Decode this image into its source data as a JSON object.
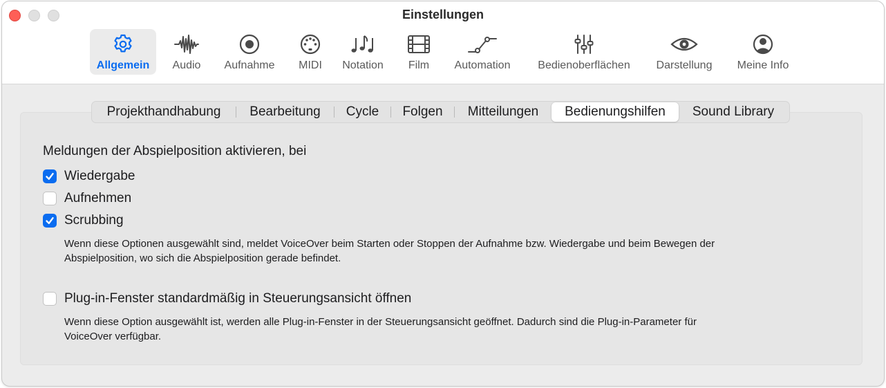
{
  "window": {
    "title": "Einstellungen"
  },
  "toolbar": {
    "items": [
      {
        "label": "Allgemein",
        "icon": "gear-icon",
        "active": true
      },
      {
        "label": "Audio",
        "icon": "waveform-icon"
      },
      {
        "label": "Aufnahme",
        "icon": "record-icon"
      },
      {
        "label": "MIDI",
        "icon": "midi-port-icon"
      },
      {
        "label": "Notation",
        "icon": "music-notes-icon"
      },
      {
        "label": "Film",
        "icon": "film-icon"
      },
      {
        "label": "Automation",
        "icon": "automation-curve-icon"
      },
      {
        "label": "Bedienoberflächen",
        "icon": "sliders-icon"
      },
      {
        "label": "Darstellung",
        "icon": "eye-icon"
      },
      {
        "label": "Meine Info",
        "icon": "person-icon"
      }
    ],
    "accent_color": "#0a6cf0"
  },
  "tabs": {
    "items": [
      {
        "label": "Projekthandhabung"
      },
      {
        "label": "Bearbeitung"
      },
      {
        "label": "Cycle"
      },
      {
        "label": "Folgen"
      },
      {
        "label": "Mitteilungen"
      },
      {
        "label": "Bedienungshilfen",
        "selected": true
      },
      {
        "label": "Sound Library"
      }
    ]
  },
  "content": {
    "heading": "Meldungen der Abspielposition aktivieren, bei",
    "checkboxes": [
      {
        "label": "Wiedergabe",
        "checked": true
      },
      {
        "label": "Aufnehmen",
        "checked": false
      },
      {
        "label": "Scrubbing",
        "checked": true
      }
    ],
    "description1_line1": "Wenn diese Optionen ausgewählt sind, meldet VoiceOver beim Starten oder Stoppen der Aufnahme bzw. Wiedergabe und beim Bewegen der",
    "description1_line2": "Abspielposition, wo sich die Abspielposition gerade befindet.",
    "plugin_option": {
      "label": "Plug-in-Fenster standardmäßig in Steuerungsansicht öffnen",
      "checked": false
    },
    "description2_line1": "Wenn diese Option ausgewählt ist, werden alle Plug-in-Fenster in der Steuerungsansicht geöffnet. Dadurch sind die Plug-in-Parameter für",
    "description2_line2": "VoiceOver verfügbar."
  }
}
